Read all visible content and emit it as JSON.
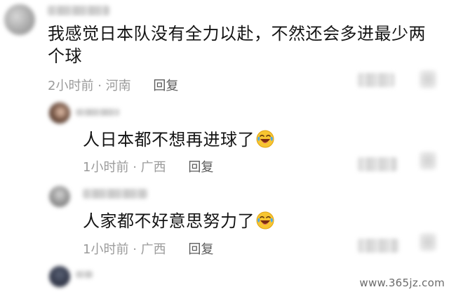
{
  "comment": {
    "text": "我感觉日本队没有全力以赴，不然还会多进最少两个球",
    "time": "2小时前",
    "location": "河南",
    "reply_label": "回复"
  },
  "replies": [
    {
      "text": "人日本都不想再进球了",
      "emoji": "laughing-tears-icon",
      "time": "1小时前",
      "location": "广西",
      "reply_label": "回复"
    },
    {
      "text": "人家都不好意思努力了",
      "emoji": "laughing-tears-icon",
      "time": "1小时前",
      "location": "广西",
      "reply_label": "回复"
    }
  ],
  "separator": "·",
  "watermark": "www.365jz.com",
  "colors": {
    "text": "#141414",
    "meta": "#9b9b9b",
    "reply_button": "#5b5b5b",
    "emoji_face": "#f7c531"
  }
}
